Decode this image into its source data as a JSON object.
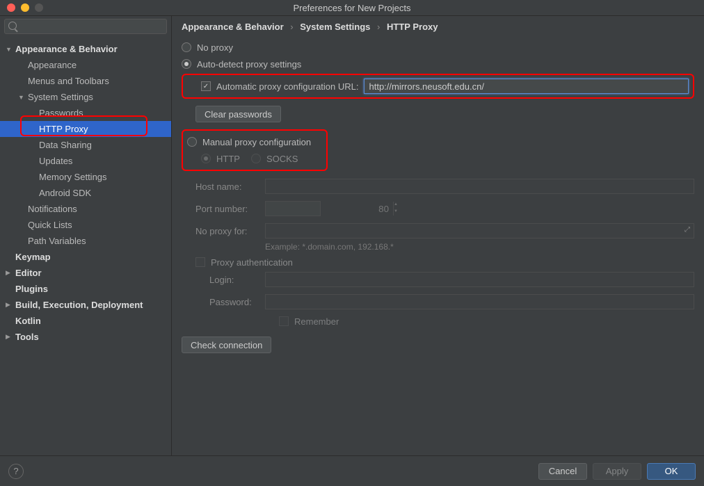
{
  "window_title": "Preferences for New Projects",
  "search_placeholder": "",
  "breadcrumb": {
    "a": "Appearance & Behavior",
    "b": "System Settings",
    "c": "HTTP Proxy"
  },
  "tree": {
    "appearance_behavior": "Appearance & Behavior",
    "appearance": "Appearance",
    "menus_toolbars": "Menus and Toolbars",
    "system_settings": "System Settings",
    "passwords": "Passwords",
    "http_proxy": "HTTP Proxy",
    "data_sharing": "Data Sharing",
    "updates": "Updates",
    "memory_settings": "Memory Settings",
    "android_sdk": "Android SDK",
    "notifications": "Notifications",
    "quick_lists": "Quick Lists",
    "path_variables": "Path Variables",
    "keymap": "Keymap",
    "editor": "Editor",
    "plugins": "Plugins",
    "build": "Build, Execution, Deployment",
    "kotlin": "Kotlin",
    "tools": "Tools"
  },
  "proxy": {
    "no_proxy": "No proxy",
    "auto_detect": "Auto-detect proxy settings",
    "auto_url_label": "Automatic proxy configuration URL:",
    "auto_url_value": "http://mirrors.neusoft.edu.cn/",
    "clear_passwords": "Clear passwords",
    "manual": "Manual proxy configuration",
    "http": "HTTP",
    "socks": "SOCKS",
    "host_name": "Host name:",
    "port_number": "Port number:",
    "port_value": "80",
    "no_proxy_for": "No proxy for:",
    "example": "Example: *.domain.com, 192.168.*",
    "proxy_auth": "Proxy authentication",
    "login": "Login:",
    "password": "Password:",
    "remember": "Remember",
    "check_connection": "Check connection"
  },
  "footer": {
    "cancel": "Cancel",
    "apply": "Apply",
    "ok": "OK"
  }
}
